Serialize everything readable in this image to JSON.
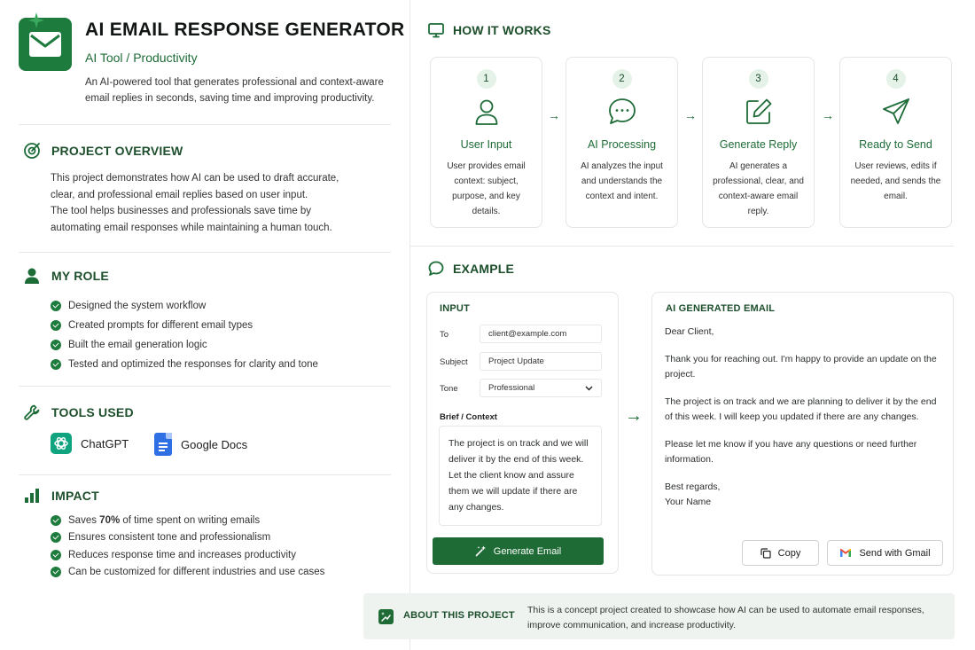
{
  "header": {
    "title": "AI EMAIL RESPONSE GENERATOR",
    "subtitle": "AI Tool / Productivity",
    "description": "An AI-powered tool that generates professional and context-aware email replies in seconds, saving time and improving productivity."
  },
  "overview": {
    "title": "PROJECT OVERVIEW",
    "paragraph_1": "This project demonstrates how AI can be used to draft accurate, clear, and professional email replies based on user input.",
    "paragraph_2": "The tool helps businesses and professionals save time by automating email responses while maintaining a human touch."
  },
  "role": {
    "title": "MY ROLE",
    "items": [
      "Designed the system workflow",
      "Created prompts for different email types",
      "Built the email generation logic",
      "Tested and optimized the responses for clarity and tone"
    ]
  },
  "tools": {
    "title": "TOOLS USED",
    "items": [
      "ChatGPT",
      "Google Docs"
    ]
  },
  "impact": {
    "title": "IMPACT",
    "first_prefix": "Saves ",
    "first_bold": "70%",
    "first_suffix": " of time spent on writing emails",
    "items": [
      "Ensures consistent tone and professionalism",
      "Reduces response time and increases productivity",
      "Can be customized for different industries and use cases"
    ]
  },
  "how": {
    "title": "HOW IT WORKS",
    "steps": [
      {
        "num": "1",
        "title": "User Input",
        "desc": "User provides email context: subject, purpose, and key details.",
        "icon": "user-icon"
      },
      {
        "num": "2",
        "title": "AI Processing",
        "desc": "AI analyzes the input and understands the context and intent.",
        "icon": "chat-bubble-icon"
      },
      {
        "num": "3",
        "title": "Generate Reply",
        "desc": "AI generates a professional, clear, and context-aware email reply.",
        "icon": "edit-icon"
      },
      {
        "num": "4",
        "title": "Ready to Send",
        "desc": "User reviews, edits if needed, and sends the email.",
        "icon": "paper-plane-icon"
      }
    ]
  },
  "example": {
    "title": "EXAMPLE",
    "input": {
      "title": "INPUT",
      "to_label": "To",
      "to_value": "client@example.com",
      "subject_label": "Subject",
      "subject_value": "Project Update",
      "tone_label": "Tone",
      "tone_value": "Professional",
      "brief_label": "Brief / Context",
      "brief_value": "The project is on track and we will deliver it by the end of this week. Let the client know and assure them we will update if there are any changes.",
      "generate_label": "Generate Email"
    },
    "output": {
      "title": "AI GENERATED EMAIL",
      "greeting": "Dear Client,",
      "p1": "Thank you for reaching out. I'm happy to provide an update on the project.",
      "p2": "The project is on track and we are planning to deliver it by the end of this week. I will keep you updated if there are any changes.",
      "p3": "Please let me know if you have any questions or need further information.",
      "closing": "Best regards,",
      "signature": "Your Name",
      "copy_label": "Copy",
      "gmail_label": "Send with Gmail"
    }
  },
  "about": {
    "title": "ABOUT THIS PROJECT",
    "text": "This is a concept project created to showcase how AI can be used to automate email responses, improve communication, and increase productivity."
  },
  "colors": {
    "accent": "#1e7b3e",
    "heading": "#1d4f2c",
    "button": "#1e6b35"
  }
}
